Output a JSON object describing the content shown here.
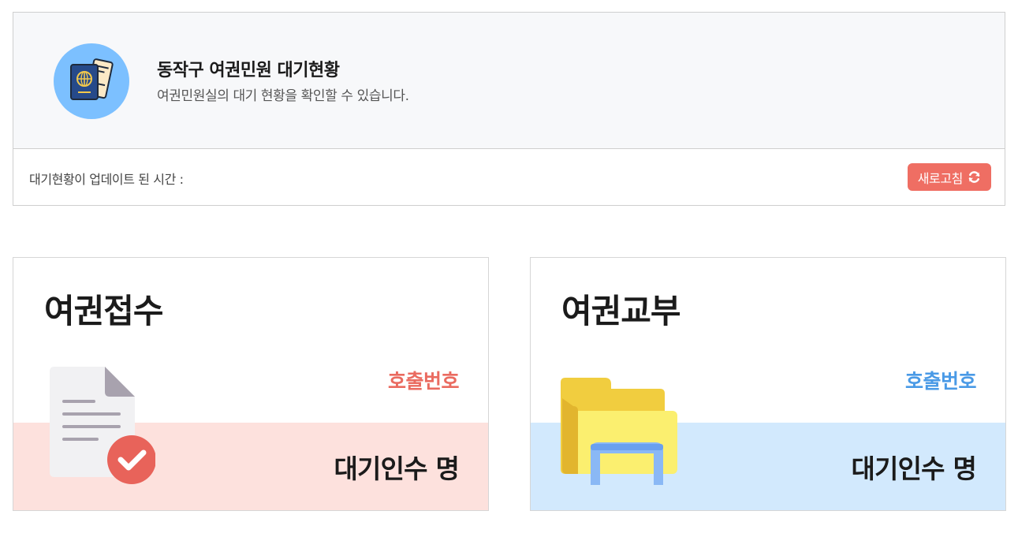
{
  "header": {
    "title": "동작구 여권민원 대기현황",
    "subtitle": "여권민원실의 대기 현황을 확인할 수 있습니다.",
    "logo_icon": "passport-icon",
    "update_label": "대기현황이 업데이트 된 시간 :",
    "refresh_label": "새로고침",
    "refresh_icon": "refresh-icon"
  },
  "cards": [
    {
      "title": "여권접수",
      "call_label": "호출번호",
      "wait_label": "대기인수",
      "wait_unit": "명",
      "icon": "document-check-icon",
      "accent": "#ea6b60",
      "band_color": "#fde1dd"
    },
    {
      "title": "여권교부",
      "call_label": "호출번호",
      "wait_label": "대기인수",
      "wait_unit": "명",
      "icon": "folder-icon",
      "accent": "#4a9ae6",
      "band_color": "#d2e9fd"
    }
  ],
  "colors": {
    "refresh_button": "#ef6e63",
    "logo_circle": "#7cc0ff"
  }
}
